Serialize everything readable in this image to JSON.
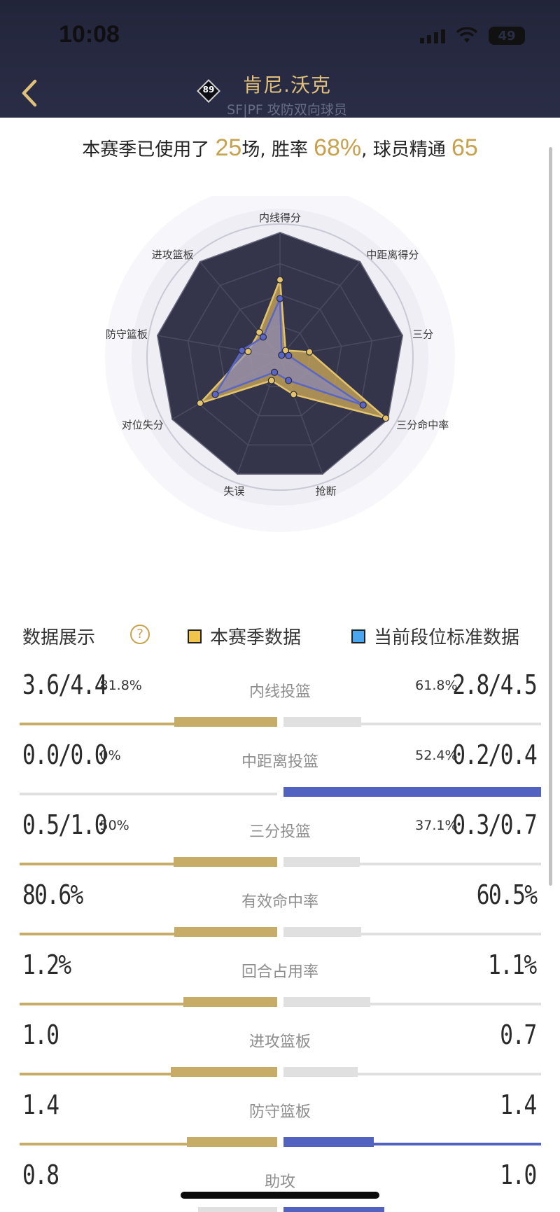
{
  "status_bar": {
    "time": "10:08",
    "battery": "49"
  },
  "header": {
    "player_name": "肯尼.沃克",
    "player_sub": "SF|PF 攻防双向球员",
    "rating": "89"
  },
  "summary": {
    "prefix": "本赛季已使用了",
    "games": "25",
    "games_unit": "场, 胜率",
    "win_rate": "68%",
    "mastery_label": ", 球员精通",
    "mastery": "65"
  },
  "radar": {
    "axes": [
      "内线得分",
      "中距离得分",
      "三分",
      "三分命中率",
      "抢断",
      "失误",
      "对位失分",
      "防守篮板",
      "进攻篮板"
    ],
    "season_values": [
      0.62,
      0.07,
      0.24,
      0.98,
      0.32,
      0.2,
      0.74,
      0.26,
      0.26
    ],
    "standard_values": [
      0.47,
      0.02,
      0.07,
      0.77,
      0.2,
      0.13,
      0.6,
      0.31,
      0.21
    ],
    "season_color": "#e3c46c",
    "standard_color": "#5966c6"
  },
  "legend": {
    "title": "数据展示",
    "help_icon": "?",
    "season_label": "本赛季数据",
    "standard_label": "当前段位标准数据",
    "season_color": "#f1c44c",
    "standard_color": "#4aa6ee"
  },
  "stats": [
    {
      "label": "内线投篮",
      "left": "3.6/4.4",
      "left_pct": "81.8%",
      "right": "2.8/4.5",
      "right_pct": "61.8%",
      "left_share": 0.57,
      "right_share": 0.43,
      "winner": "left"
    },
    {
      "label": "中距离投篮",
      "left": "0.0/0.0",
      "left_pct": "0%",
      "right": "0.2/0.4",
      "right_pct": "52.4%",
      "left_share": 0.0,
      "right_share": 1.0,
      "winner": "right"
    },
    {
      "label": "三分投篮",
      "left": "0.5/1.0",
      "left_pct": "50%",
      "right": "0.3/0.7",
      "right_pct": "37.1%",
      "left_share": 0.575,
      "right_share": 0.425,
      "winner": "left"
    },
    {
      "label": "有效命中率",
      "left": "80.6%",
      "left_pct": "",
      "right": "60.5%",
      "right_pct": "",
      "left_share": 0.57,
      "right_share": 0.43,
      "winner": "left"
    },
    {
      "label": "回合占用率",
      "left": "1.2%",
      "left_pct": "",
      "right": "1.1%",
      "right_pct": "",
      "left_share": 0.52,
      "right_share": 0.48,
      "winner": "left"
    },
    {
      "label": "进攻篮板",
      "left": "1.0",
      "left_pct": "",
      "right": "0.7",
      "right_pct": "",
      "left_share": 0.59,
      "right_share": 0.41,
      "winner": "left"
    },
    {
      "label": "防守篮板",
      "left": "1.4",
      "left_pct": "",
      "right": "1.4",
      "right_pct": "",
      "left_share": 0.5,
      "right_share": 0.5,
      "winner": "both"
    },
    {
      "label": "助攻",
      "left": "0.8",
      "left_pct": "",
      "right": "1.0",
      "right_pct": "",
      "left_share": 0.44,
      "right_share": 0.56,
      "winner": "right"
    }
  ],
  "colors": {
    "gold": "#c7ac68",
    "blue": "#5162c0",
    "grey": "#e0e0e0"
  }
}
